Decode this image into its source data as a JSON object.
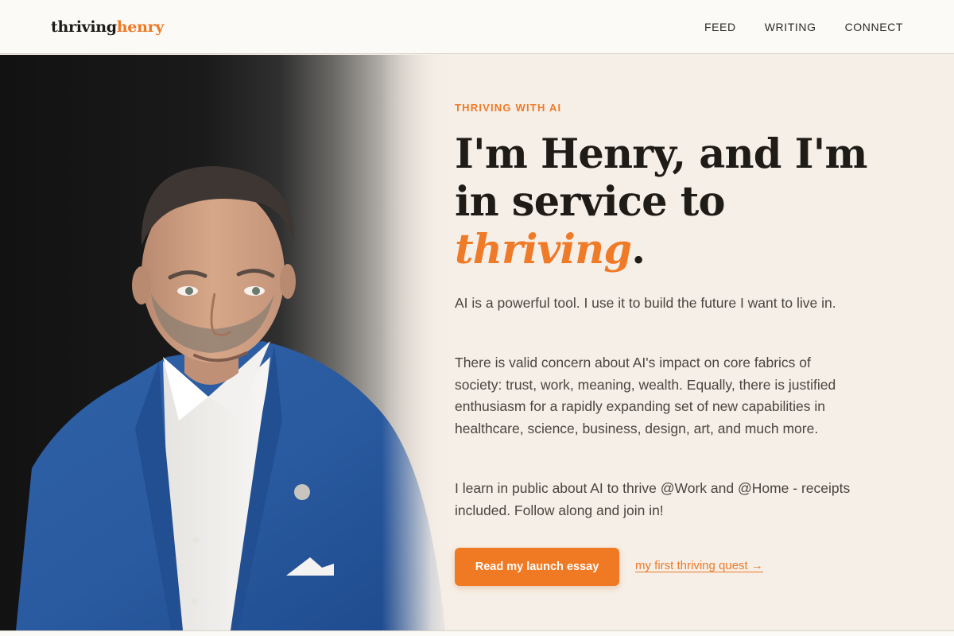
{
  "header": {
    "logo_part1": "thriving",
    "logo_part2": "henry",
    "nav": [
      "FEED",
      "WRITING",
      "CONNECT"
    ]
  },
  "hero": {
    "eyebrow": "THRIVING WITH AI",
    "headline_line1": "I'm Henry, and I'm",
    "headline_line2": "in service to",
    "headline_accent": "thriving",
    "headline_end": ".",
    "paragraph1": "AI is a powerful tool. I use it to build the future I want to live in.",
    "paragraph2": "There is valid concern about AI's impact on core fabrics of society: trust, work, meaning, wealth. Equally, there is justified enthusiasm for a rapidly expanding set of new capabilities in healthcare, science, business, design, art, and much more.",
    "paragraph3": "I learn in public about AI to thrive @Work and @Home - receipts included. Follow along and join in!",
    "cta_label": "Read my launch essay",
    "link_label": "my first thriving quest →"
  },
  "colors": {
    "accent": "#ef7a27",
    "background": "#f6efe7",
    "header_bg": "#fbfaf7",
    "text": "#1f1c18"
  }
}
